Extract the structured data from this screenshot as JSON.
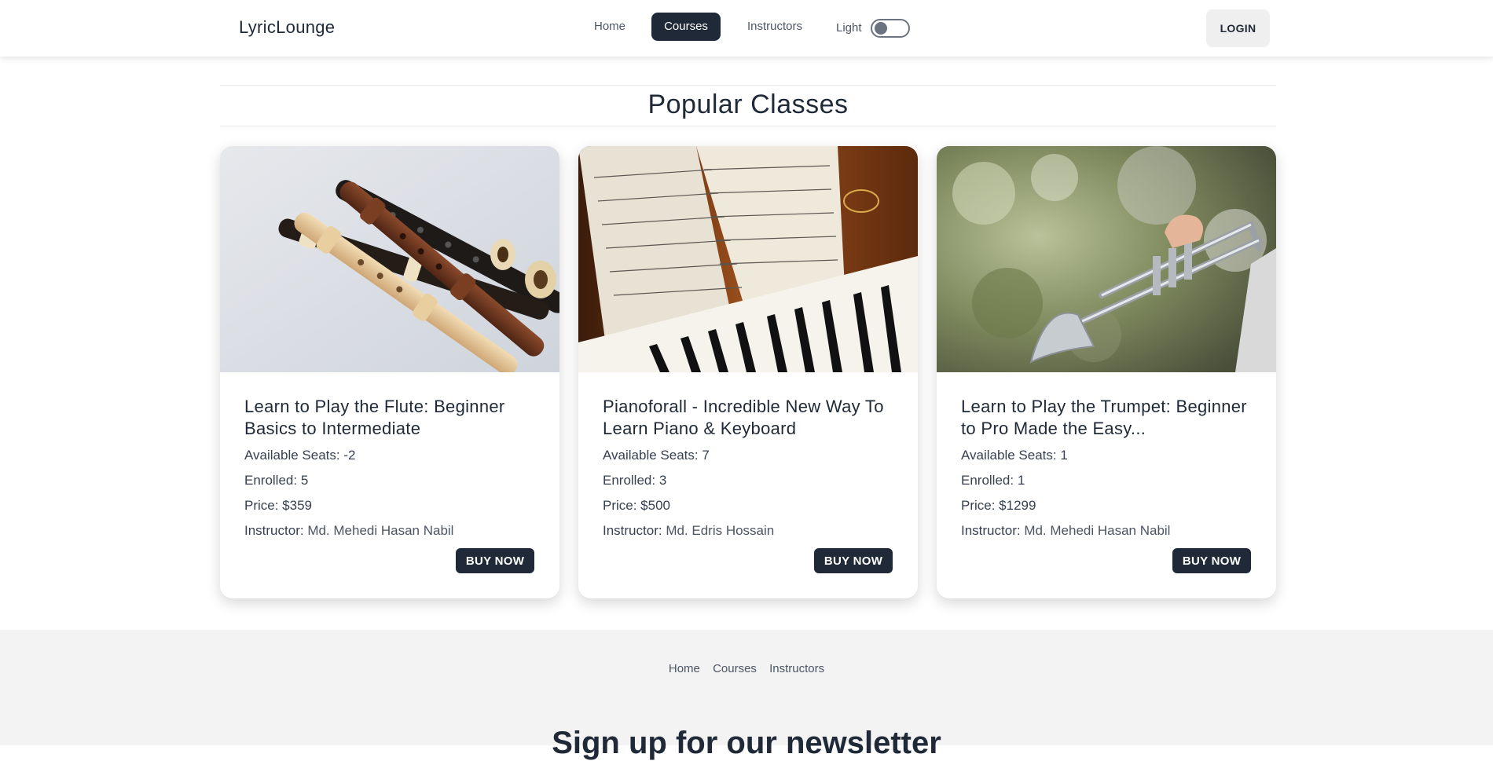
{
  "navbar": {
    "brand": "LyricLounge",
    "links": [
      "Home",
      "Courses",
      "Instructors"
    ],
    "active": "Courses",
    "theme_label": "Light",
    "login_label": "LOGIN"
  },
  "main": {
    "section_title": "Popular Classes",
    "card_seats_label": "Available Seats: ",
    "card_enrolled_label": "Enrolled: ",
    "card_price_label": "Price: $",
    "card_instructor_label": "Instructor: ",
    "buy_label": "BUY NOW",
    "cards": [
      {
        "image": "flutes-photo",
        "title": "Learn to Play the Flute: Beginner Basics to Intermediate",
        "seats": "-2",
        "enrolled": "5",
        "price": "359",
        "instructor": "Md. Mehedi Hasan Nabil"
      },
      {
        "image": "piano-sheet-music-photo",
        "title": "Pianoforall - Incredible New Way To Learn Piano & Keyboard",
        "seats": "7",
        "enrolled": "3",
        "price": "500",
        "instructor": "Md. Edris Hossain"
      },
      {
        "image": "trumpet-photo",
        "title": "Learn to Play the Trumpet: Beginner to Pro Made the Easy...",
        "seats": "1",
        "enrolled": "1",
        "price": "1299",
        "instructor": "Md. Mehedi Hasan Nabil"
      }
    ]
  },
  "footer": {
    "links": [
      "Home",
      "Courses",
      "Instructors"
    ],
    "newsletter_title": "Sign up for our newsletter"
  },
  "colors": {
    "primary_dark": "#1f2937",
    "footer_bg": "#f3f3f3",
    "login_bg": "#efefef"
  }
}
